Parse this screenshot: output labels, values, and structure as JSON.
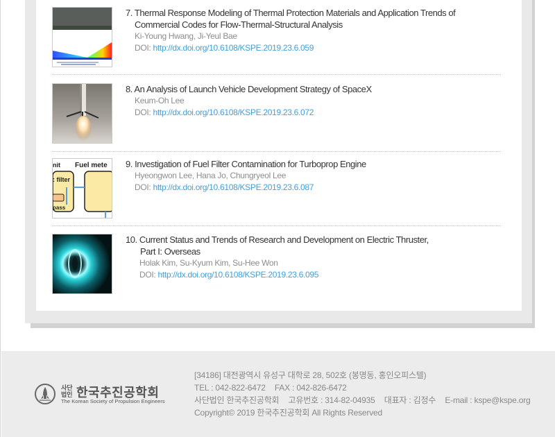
{
  "articles": [
    {
      "number": "7.",
      "title_line1": "Thermal Response Modeling of Thermal Protection Materials and Application Trends of",
      "title_line2": "Commercial Codes for Flow-Thermal-Structural Analysis",
      "authors": "Ki-Young Hwang, Ji-Yeul Bae",
      "doi_label": "DOI:",
      "doi_link": "http://dx.doi.org/10.6108/KSPE.2019.23.6.059",
      "thumb_icon": "thermal-simulation-image"
    },
    {
      "number": "8.",
      "title_line1": "An Analysis of Launch Vehicle Development Strategy of SpaceX",
      "title_line2": "",
      "authors": "Keum-Oh Lee",
      "doi_label": "DOI:",
      "doi_link": "http://dx.doi.org/10.6108/KSPE.2019.23.6.072",
      "thumb_icon": "rocket-landing-image"
    },
    {
      "number": "9.",
      "title_line1": "Investigation of Fuel Filter Contamination for Turboprop Engine",
      "title_line2": "",
      "authors": "Hyeongwon Lee, Hana Jo, Chungryeol Lee",
      "doi_label": "DOI:",
      "doi_link": "http://dx.doi.org/10.6108/KSPE.2019.23.6.087",
      "thumb_icon": "fuel-filter-diagram-image",
      "thumb_text": [
        "nit",
        "Fuel mete",
        ": filter",
        "oass"
      ]
    },
    {
      "number": "10.",
      "title_line1": "Current Status and Trends of Research and Development on Electric Thruster,",
      "title_line2": "Part I: Overseas",
      "authors": "Holak Kim, Su-Kyum Kim, Su-Hee Won",
      "doi_label": "DOI:",
      "doi_link": "http://dx.doi.org/10.6108/KSPE.2019.23.6.095",
      "thumb_icon": "electric-thruster-image"
    }
  ],
  "footer": {
    "logo_small": "사단 법인",
    "logo_name": "한국추진공학회",
    "logo_en": "The Korean Society of Propulsion Engineers",
    "address": "[34186] 대전광역시 유성구 대학로 28, 502호 (봉명동, 홍인오피스텔)",
    "tel": "TEL : 042-822-6472",
    "fax": "FAX : 042-826-6472",
    "org": "사단법인 한국추진공학회",
    "reg_no": "고유번호 : 314-82-04935",
    "rep": "대표자 : 김정수",
    "email": "E-mail : kspe@kspe.org",
    "copyright": "Copyright© 2019 한국추진공학회 All Rights Reserved"
  },
  "colors": {
    "link": "#3f9fd9",
    "title": "#333333",
    "meta": "#8d8d8d",
    "footer_bg": "#ececec"
  }
}
